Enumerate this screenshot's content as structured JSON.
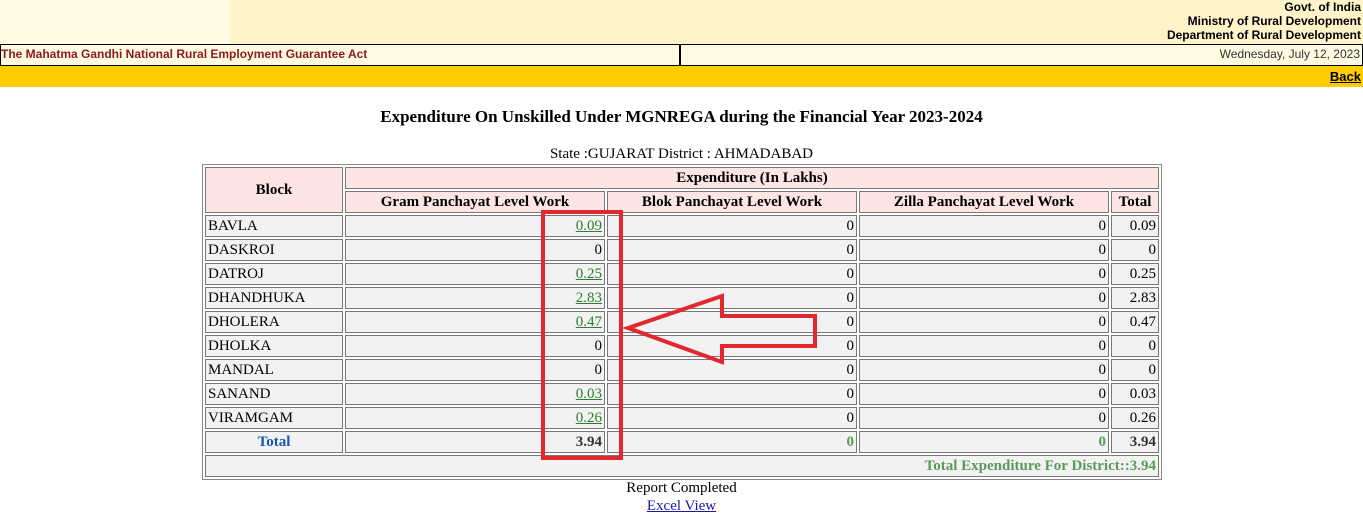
{
  "header": {
    "gov_lines": [
      "Govt. of India",
      "Ministry of Rural Development",
      "Department of Rural Development"
    ],
    "act_title": "The Mahatma Gandhi National Rural Employment Guarantee Act",
    "date": "Wednesday, July 12, 2023",
    "back_label": "Back"
  },
  "report": {
    "title": "Expenditure On Unskilled Under MGNREGA during the Financial Year 2023-2024",
    "state_line": "State :GUJARAT District : AHMADABAD",
    "header_block": "Block",
    "header_expenditure": "Expenditure  (In Lakhs)",
    "columns": [
      "Gram Panchayat Level Work",
      "Blok Panchayat Level Work",
      "Zilla Panchayat Level Work",
      "Total"
    ],
    "rows": [
      {
        "block": "BAVLA",
        "gp": "0.09",
        "gp_link": true,
        "bp": "0",
        "zp": "0",
        "total": "0.09"
      },
      {
        "block": "DASKROI",
        "gp": "0",
        "gp_link": false,
        "bp": "0",
        "zp": "0",
        "total": "0"
      },
      {
        "block": "DATROJ",
        "gp": "0.25",
        "gp_link": true,
        "bp": "0",
        "zp": "0",
        "total": "0.25"
      },
      {
        "block": "DHANDHUKA",
        "gp": "2.83",
        "gp_link": true,
        "bp": "0",
        "zp": "0",
        "total": "2.83"
      },
      {
        "block": "DHOLERA",
        "gp": "0.47",
        "gp_link": true,
        "bp": "0",
        "zp": "0",
        "total": "0.47"
      },
      {
        "block": "DHOLKA",
        "gp": "0",
        "gp_link": false,
        "bp": "0",
        "zp": "0",
        "total": "0"
      },
      {
        "block": "MANDAL",
        "gp": "0",
        "gp_link": false,
        "bp": "0",
        "zp": "0",
        "total": "0"
      },
      {
        "block": "SANAND",
        "gp": "0.03",
        "gp_link": true,
        "bp": "0",
        "zp": "0",
        "total": "0.03"
      },
      {
        "block": "VIRAMGAM",
        "gp": "0.26",
        "gp_link": true,
        "bp": "0",
        "zp": "0",
        "total": "0.26"
      }
    ],
    "total_row": {
      "label": "Total",
      "gp": "3.94",
      "bp": "0",
      "zp": "0",
      "total": "3.94"
    },
    "district_total": "Total Expenditure For District::3.94",
    "status": "Report Completed",
    "excel_label": "Excel View"
  },
  "colors": {
    "header_yellow": "#ffcc00",
    "act_red": "#8b1a1a",
    "link_green": "#2e7d32",
    "annotation_red": "#e0282e"
  }
}
